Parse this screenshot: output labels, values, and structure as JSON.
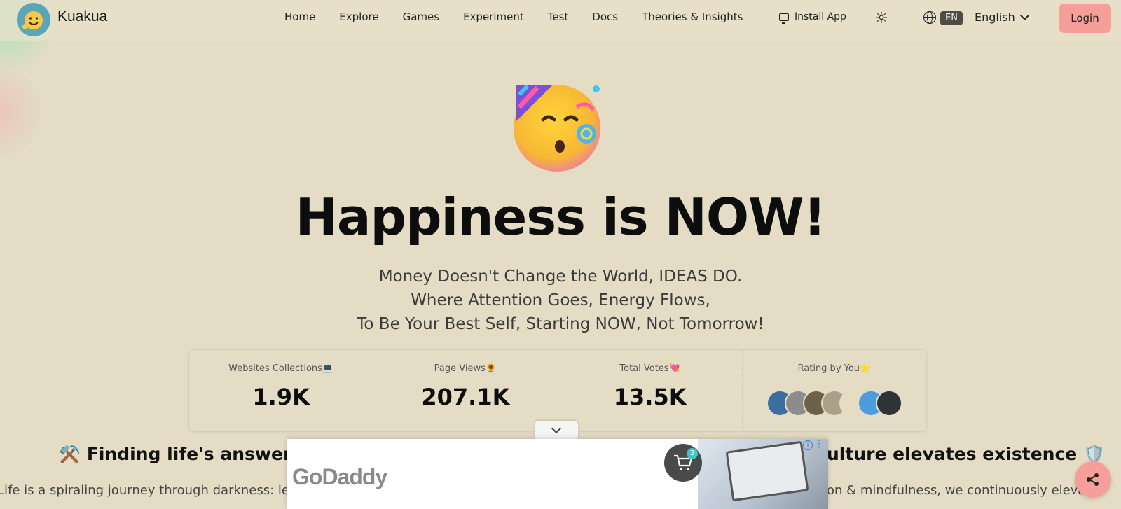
{
  "brand": {
    "name": "Kuakua",
    "logo_icon": "smiling-face-logo"
  },
  "nav": {
    "links": [
      "Home",
      "Explore",
      "Games",
      "Experiment",
      "Test",
      "Docs",
      "Theories & Insights"
    ],
    "install_label": "Install App",
    "theme_icon": "sun-icon",
    "lang_code": "EN",
    "lang_label": "English",
    "login_label": "Login"
  },
  "hero": {
    "emoji": "partying-face-icon",
    "title": "Happiness is NOW!",
    "subtitle_lines": [
      "Money Doesn't Change the World, IDEAS DO.",
      "Where Attention Goes, Energy Flows,",
      "To Be Your Best Self, Starting NOW, Not Tomorrow!"
    ]
  },
  "stats": [
    {
      "label": "Websites Collections💻",
      "value": "1.9K"
    },
    {
      "label": "Page Views🌻",
      "value": "207.1K"
    },
    {
      "label": "Total Votes💘",
      "value": "13.5K"
    },
    {
      "label": "Rating by You⭐"
    }
  ],
  "avatar_colors": [
    "#3b6fa0",
    "#8c8c8c",
    "#6d6048",
    "#a9a08a",
    "#e7dbc4",
    "#4e9be0",
    "#2f3336"
  ],
  "sections": {
    "left_heading": "⚒️ Finding life's answers th",
    "right_heading": "ulture elevates existence 🛡️",
    "left_para": "Life is a spiraling journey through darkness: le",
    "right_para": "on & mindfulness, we continuously eleva"
  },
  "ad": {
    "brand": "GoDaddy",
    "cart_count": "3",
    "info_label": "i",
    "more_label": "⋮"
  },
  "colors": {
    "background": "#e4dcc4",
    "accent": "#f59e9a",
    "text": "#111111"
  }
}
